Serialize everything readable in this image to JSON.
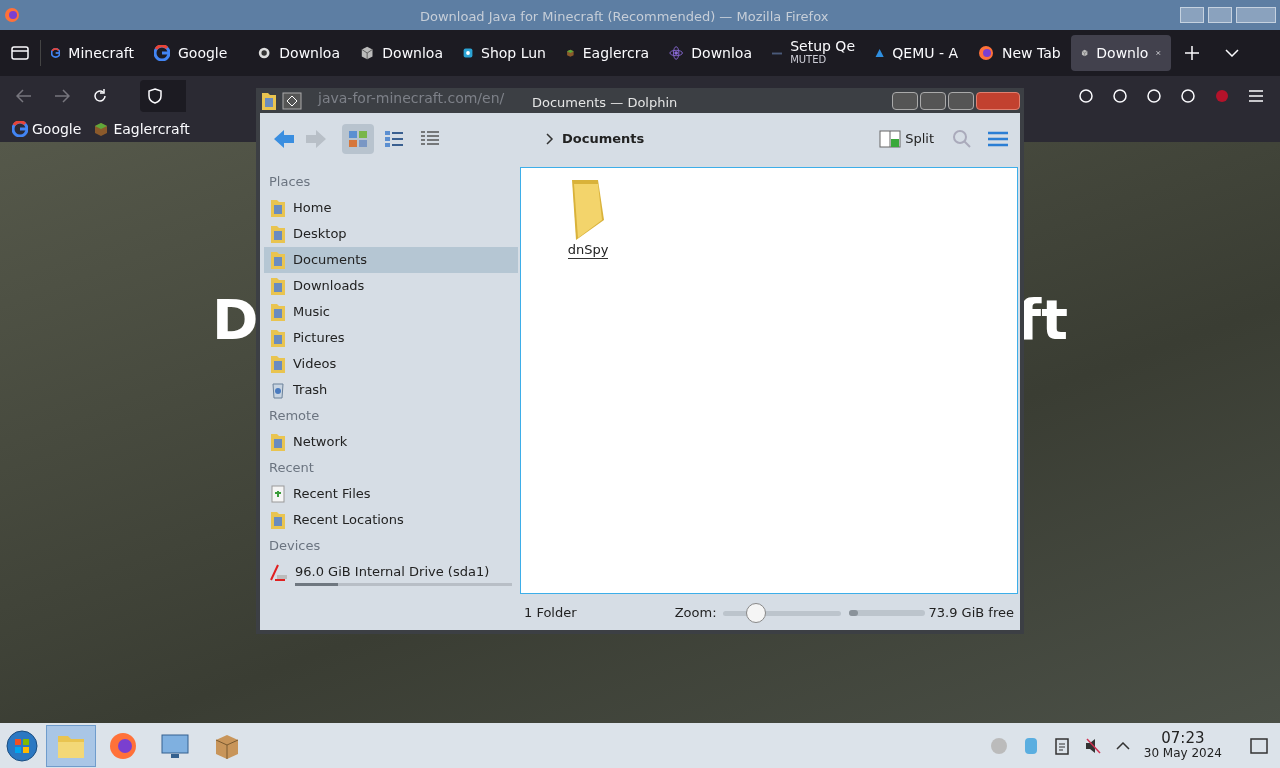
{
  "browser": {
    "window_title": "Download Java for Minecraft (Recommended) — Mozilla Firefox",
    "tabs": [
      {
        "label": "Minecraft",
        "kind": "google",
        "selected": false
      },
      {
        "label": "Google",
        "kind": "google",
        "selected": false
      },
      {
        "label": "Downloa",
        "kind": "page",
        "selected": false
      },
      {
        "label": "Downloa",
        "kind": "cube",
        "selected": false
      },
      {
        "label": "Shop Lun",
        "kind": "shop",
        "selected": false
      },
      {
        "label": "Eaglercra",
        "kind": "grass",
        "selected": false
      },
      {
        "label": "Downloa",
        "kind": "atom",
        "selected": false
      },
      {
        "label": "Setup Qe",
        "kind": "setup",
        "selected": false,
        "sublabel": "MUTED"
      },
      {
        "label": "QEMU - A",
        "kind": "qemu",
        "selected": false
      },
      {
        "label": "New Tab",
        "kind": "firefox",
        "selected": false
      },
      {
        "label": "Downlo",
        "kind": "cube",
        "selected": true
      }
    ],
    "address": "java-for-minecraft.com/en/",
    "bookmarks": [
      {
        "label": "Google",
        "kind": "google"
      },
      {
        "label": "Eaglercraft",
        "kind": "grass"
      }
    ],
    "heading_left": "D",
    "heading_right": "ft"
  },
  "dolphin": {
    "title": "Documents — Dolphin",
    "view_modes": [
      {
        "kind": "icons",
        "selected": true
      },
      {
        "kind": "compact",
        "selected": false
      },
      {
        "kind": "details",
        "selected": false
      }
    ],
    "breadcrumb": "Documents",
    "split_label": "Split",
    "sidebar": [
      {
        "heading": "Places",
        "items": [
          {
            "label": "Home",
            "kind": "place",
            "selected": false
          },
          {
            "label": "Desktop",
            "kind": "place",
            "selected": false
          },
          {
            "label": "Documents",
            "kind": "place",
            "selected": true
          },
          {
            "label": "Downloads",
            "kind": "place",
            "selected": false
          },
          {
            "label": "Music",
            "kind": "place",
            "selected": false
          },
          {
            "label": "Pictures",
            "kind": "place",
            "selected": false
          },
          {
            "label": "Videos",
            "kind": "place",
            "selected": false
          },
          {
            "label": "Trash",
            "kind": "trash",
            "selected": false
          }
        ]
      },
      {
        "heading": "Remote",
        "items": [
          {
            "label": "Network",
            "kind": "place",
            "selected": false
          }
        ]
      },
      {
        "heading": "Recent",
        "items": [
          {
            "label": "Recent Files",
            "kind": "recent",
            "selected": false
          },
          {
            "label": "Recent Locations",
            "kind": "place",
            "selected": false
          }
        ]
      },
      {
        "heading": "Devices",
        "items": [
          {
            "label": "96.0 GiB Internal Drive (sda1)",
            "kind": "drive",
            "selected": false,
            "level": 0.2
          }
        ]
      }
    ],
    "files": [
      {
        "name": "dnSpy"
      }
    ],
    "status": "1 Folder",
    "zoom_label": "Zoom:",
    "zoom": {
      "level": 0.28
    },
    "space": {
      "level": 0.13
    },
    "free_text": "73.9 GiB free"
  },
  "taskbar": {
    "apps": [
      {
        "kind": "files",
        "selected": true
      },
      {
        "kind": "firefox",
        "selected": false
      },
      {
        "kind": "monitor",
        "selected": false
      },
      {
        "kind": "package",
        "selected": false
      }
    ],
    "time": "07:23",
    "date": "30 May 2024"
  }
}
